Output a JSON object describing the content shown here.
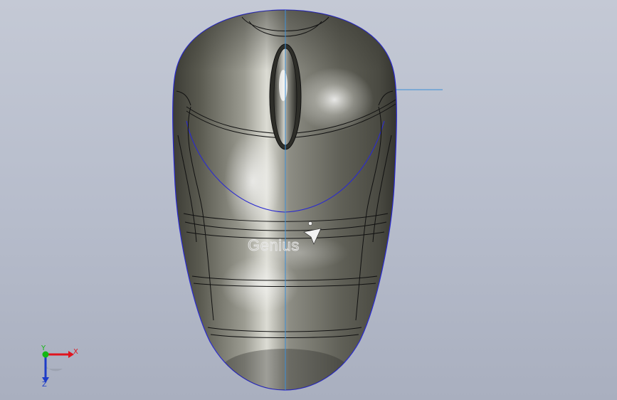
{
  "model": {
    "brand_label": "Genius"
  },
  "triad": {
    "x_label": "X",
    "y_label": "Y",
    "z_label": "Z",
    "x_color": "#e0141e",
    "y_color": "#14b814",
    "z_color": "#1e3cc8"
  },
  "colors": {
    "body_dark": "#3a3a33",
    "body_light": "#d8d8d0",
    "edge_line": "#111111",
    "silhouette": "#2a2ad0",
    "sketch_line": "#3b8fd8",
    "background_top": "#c4c9d5",
    "background_bottom": "#a9afbf"
  }
}
